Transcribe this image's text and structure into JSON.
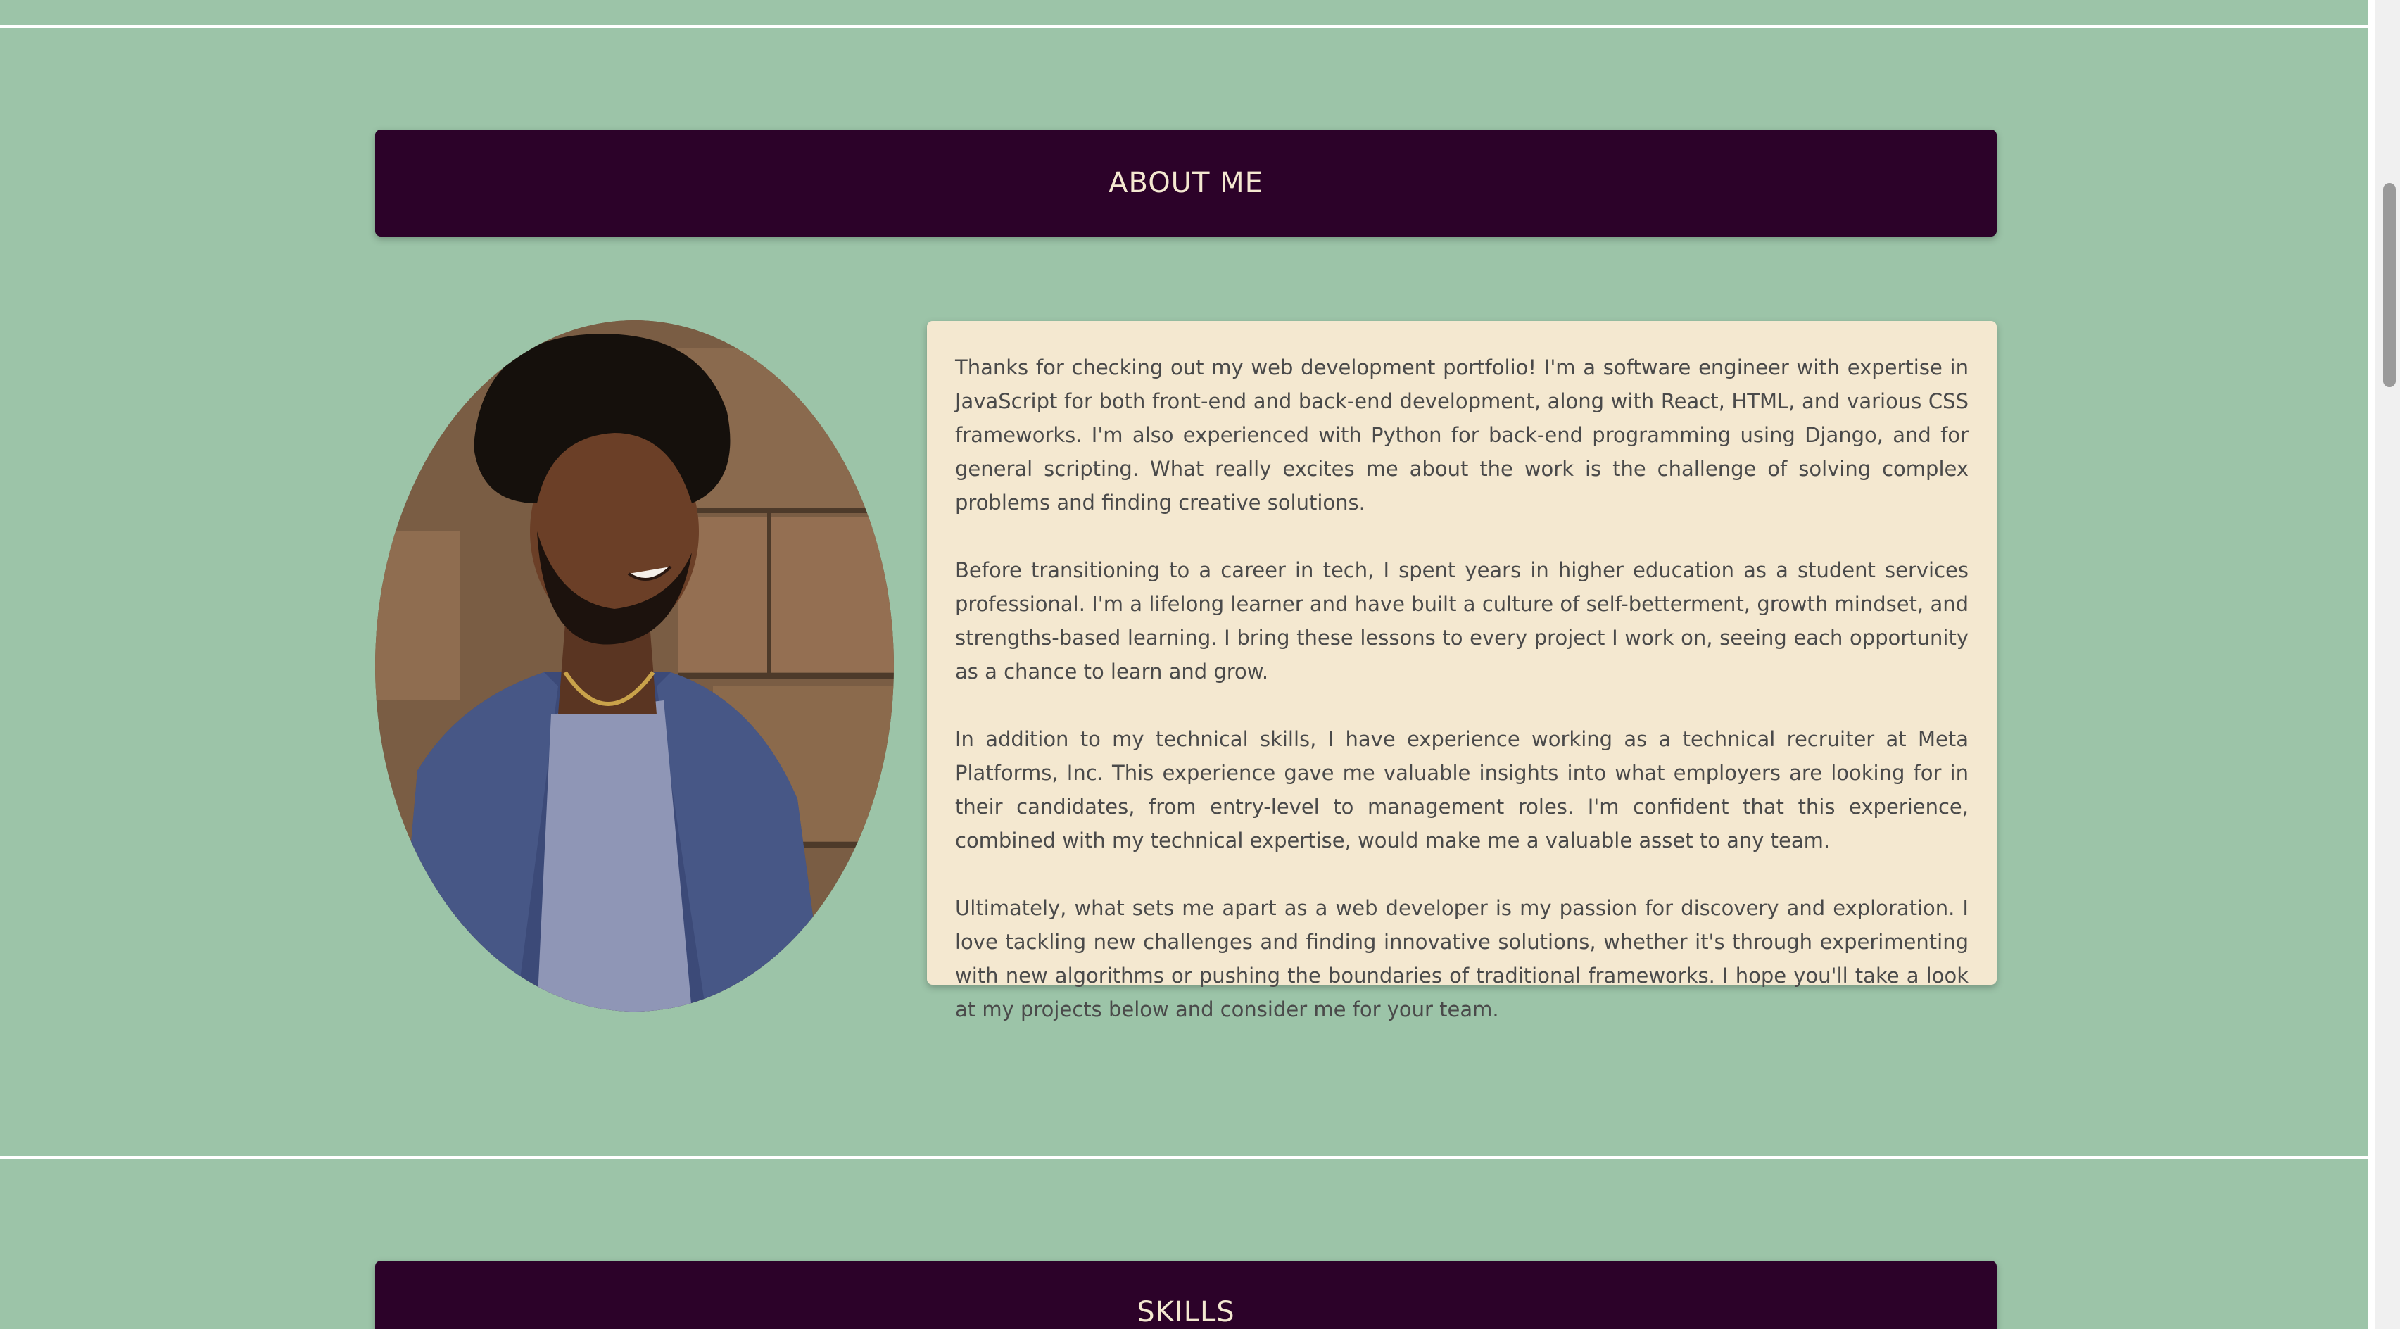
{
  "about": {
    "heading": "ABOUT ME",
    "paragraphs": [
      "Thanks for checking out my web development portfolio! I'm a software engineer with expertise in JavaScript for both front-end and back-end development, along with React, HTML, and various CSS frameworks. I'm also experienced with Python for back-end programming using Django, and for general scripting. What really excites me about the work is the challenge of solving complex problems and finding creative solutions.",
      "Before transitioning to a career in tech, I spent years in higher education as a student services professional. I'm a lifelong learner and have built a culture of self-betterment, growth mindset, and strengths-based learning. I bring these lessons to every project I work on, seeing each opportunity as a chance to learn and grow.",
      "In addition to my technical skills, I have experience working as a technical recruiter at Meta Platforms, Inc. This experience gave me valuable insights into what employers are looking for in their candidates, from entry-level to management roles. I'm confident that this experience, combined with my technical expertise, would make me a valuable asset to any team.",
      "Ultimately, what sets me apart as a web developer is my passion for discovery and exploration. I love tackling new challenges and finding innovative solutions, whether it's through experimenting with new algorithms or pushing the boundaries of traditional frameworks. I hope you'll take a look at my projects below and consider me for your team."
    ]
  },
  "skills": {
    "heading": "SKILLS"
  },
  "colors": {
    "background": "#9cc4a8",
    "header_bg": "#2c0229",
    "header_text": "#f4e8d0",
    "card_bg": "#f4e8d0",
    "body_text": "#4a4a4a"
  },
  "icons": {
    "portrait": "profile-photo"
  }
}
